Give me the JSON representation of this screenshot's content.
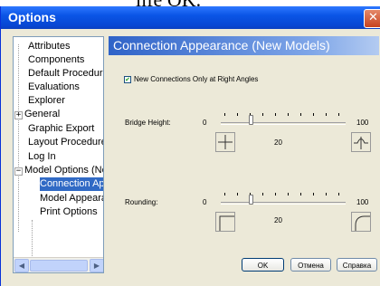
{
  "window": {
    "title": "Options"
  },
  "tree": {
    "items": [
      {
        "label": "Attributes"
      },
      {
        "label": "Components"
      },
      {
        "label": "Default Procedures"
      },
      {
        "label": "Evaluations"
      },
      {
        "label": "Explorer"
      },
      {
        "label": "General"
      },
      {
        "label": "Graphic Export"
      },
      {
        "label": "Layout Procedures"
      },
      {
        "label": "Log In"
      },
      {
        "label": "Model Options (New Models)"
      },
      {
        "label": "Connection Appearance"
      },
      {
        "label": "Model Appearance"
      },
      {
        "label": "Print Options"
      }
    ]
  },
  "panel": {
    "title": "Connection Appearance (New Models)",
    "right_angles": {
      "label": "New Connections Only at Right Angles",
      "checked": true
    },
    "bridge_height": {
      "label": "Bridge Height:",
      "min": "0",
      "max": "100",
      "value": "20",
      "level": 20
    },
    "rounding": {
      "label": "Rounding:",
      "min": "0",
      "max": "100",
      "value": "20",
      "level": 20
    }
  },
  "buttons": {
    "ok": "OK",
    "cancel": "Отмена",
    "help": "Справка"
  },
  "colors": {
    "title_bar": "#0a55e6",
    "selection": "#316ac5",
    "panel_header": "#2f63c8"
  }
}
